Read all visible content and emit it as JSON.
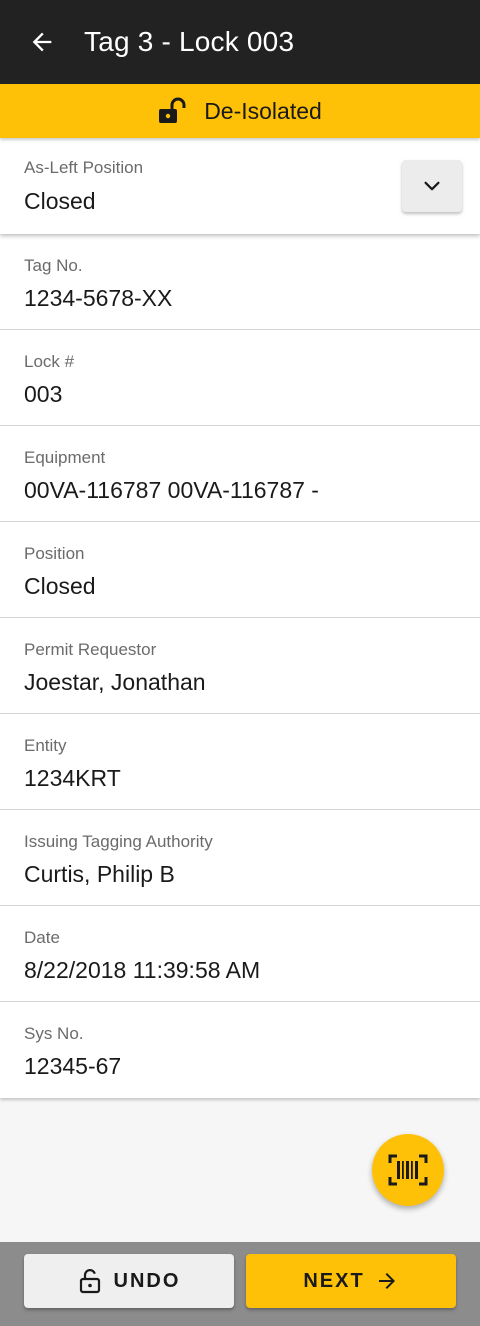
{
  "header": {
    "title": "Tag 3 - Lock 003",
    "back_icon": "arrow-left-icon"
  },
  "status": {
    "label": "De-Isolated",
    "icon": "unlocked-padlock-icon",
    "color": "#ffc107"
  },
  "as_left": {
    "label": "As-Left Position",
    "value": "Closed",
    "dropdown_icon": "chevron-down-icon"
  },
  "fields": [
    {
      "label": "Tag No.",
      "value": "1234-5678-XX"
    },
    {
      "label": "Lock #",
      "value": "003"
    },
    {
      "label": "Equipment",
      "value": "00VA-116787 00VA-116787 -"
    },
    {
      "label": "Position",
      "value": "Closed"
    },
    {
      "label": "Permit Requestor",
      "value": "Joestar, Jonathan"
    },
    {
      "label": "Entity",
      "value": "1234KRT"
    },
    {
      "label": "Issuing Tagging Authority",
      "value": "Curtis, Philip B"
    },
    {
      "label": "Date",
      "value": "8/22/2018 11:39:58 AM"
    },
    {
      "label": "Sys No.",
      "value": "12345-67"
    }
  ],
  "fab": {
    "icon": "barcode-scan-icon"
  },
  "footer": {
    "undo_label": "UNDO",
    "undo_icon": "unlock-icon",
    "next_label": "NEXT",
    "next_icon": "arrow-right-icon"
  },
  "colors": {
    "accent": "#ffc107",
    "appbar": "#222222"
  }
}
